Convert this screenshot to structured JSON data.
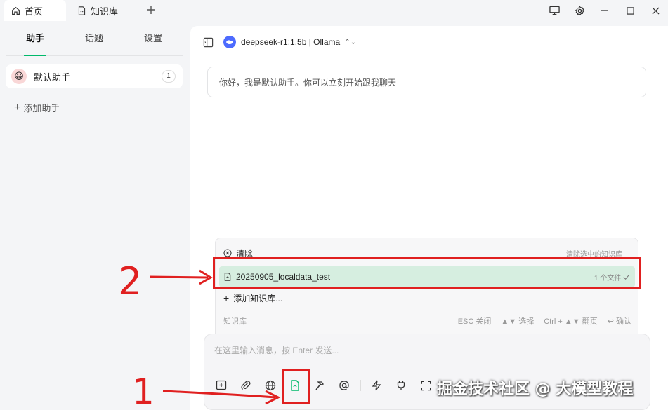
{
  "tabs": [
    {
      "label": "首页",
      "icon": "home-icon"
    },
    {
      "label": "知识库",
      "icon": "knowledge-file-icon"
    }
  ],
  "sidebar": {
    "tabs": [
      {
        "label": "助手"
      },
      {
        "label": "话题"
      },
      {
        "label": "设置"
      }
    ],
    "assistant": {
      "name": "默认助手",
      "count": "1"
    },
    "add_label": "添加助手"
  },
  "main": {
    "model_label": "deepseek-r1:1.5b | Ollama",
    "greeting": "你好，我是默认助手。你可以立刻开始跟我聊天"
  },
  "kb_popup": {
    "clear_label": "清除",
    "clear_hint": "清除选中的知识库",
    "item_name": "20250905_localdata_test",
    "item_hint": "1 个文件",
    "add_label": "添加知识库...",
    "footer_label": "知识库",
    "keys": [
      "ESC 关闭",
      "▲▼ 选择",
      "Ctrl + ▲▼ 翻页",
      "↩ 确认"
    ]
  },
  "input": {
    "placeholder": "在这里输入消息，按 Enter 发送..."
  },
  "annotations": {
    "mark_1": "1",
    "mark_2": "2"
  },
  "watermark": "掘金技术社区 @ 大模型教程",
  "colors": {
    "accent": "#00b96b",
    "highlight": "#e02020",
    "selected_row": "#d6eee0"
  }
}
